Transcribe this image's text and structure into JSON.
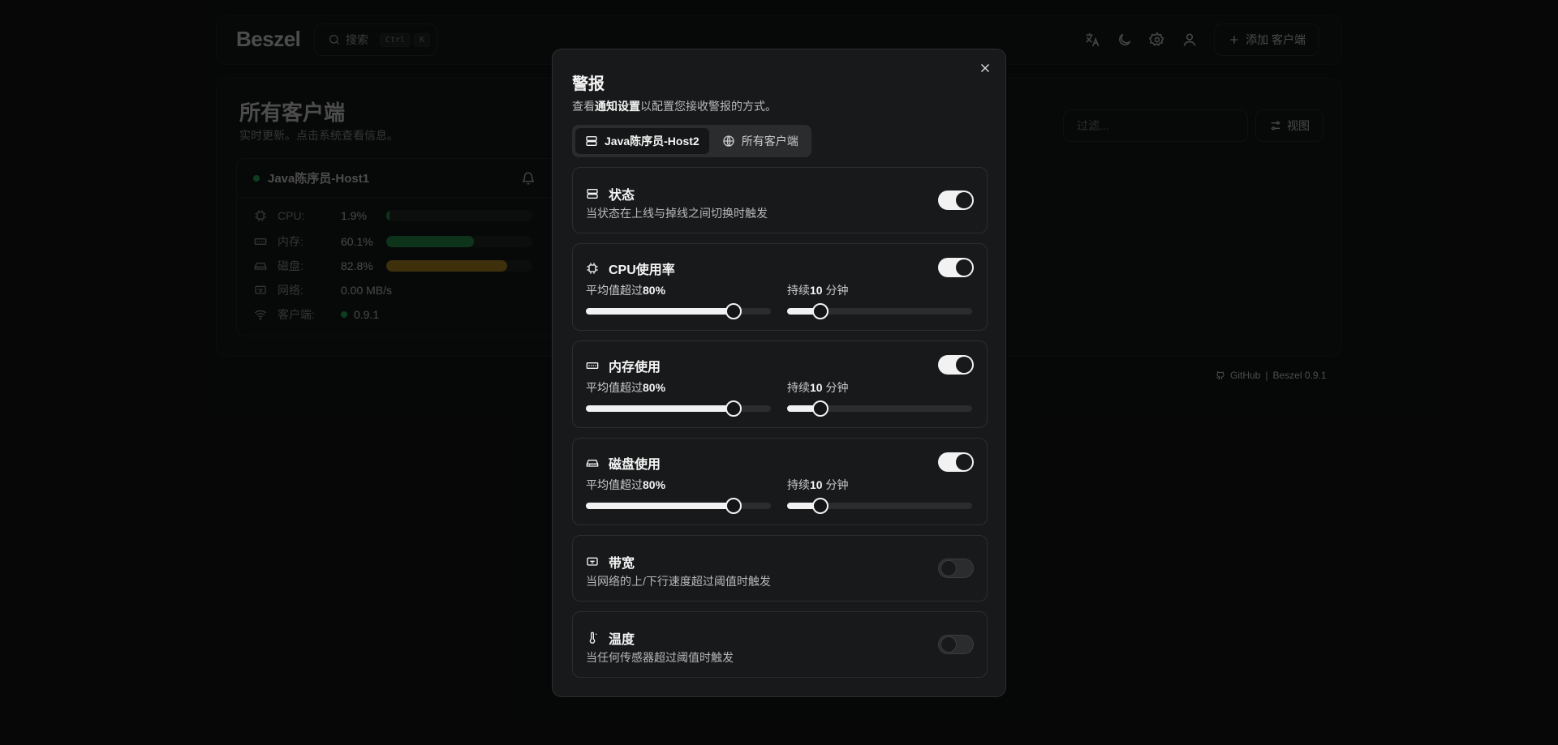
{
  "header": {
    "logo": "Beszel",
    "search_label": "搜索",
    "search_kbd1": "Ctrl",
    "search_kbd2": "K",
    "add_client_label": "添加 客户端"
  },
  "main": {
    "title": "所有客户端",
    "subtitle": "实时更新。点击系统查看信息。",
    "filter_placeholder": "过滤...",
    "view_label": "视图",
    "system": {
      "name": "Java陈序员-Host1",
      "metrics": [
        {
          "label": "CPU:",
          "value": "1.9%",
          "percent": 1.9,
          "color": "#22a34f"
        },
        {
          "label": "内存:",
          "value": "60.1%",
          "percent": 60.1,
          "color": "#22a34f"
        },
        {
          "label": "磁盘:",
          "value": "82.8%",
          "percent": 82.8,
          "color": "#c7961a"
        },
        {
          "label": "网络:",
          "value": "0.00 MB/s"
        },
        {
          "label": "客户端:",
          "value": "0.9.1"
        }
      ]
    }
  },
  "footer": {
    "github": "GitHub",
    "separator": "|",
    "version": "Beszel 0.9.1"
  },
  "dialog": {
    "title": "警报",
    "desc_prefix": "查看",
    "desc_link": "通知设置",
    "desc_suffix": "以配置您接收警报的方式。",
    "tabs": [
      {
        "label": "Java陈序员-Host2",
        "active": true
      },
      {
        "label": "所有客户端",
        "active": false
      }
    ],
    "alerts": [
      {
        "title": "状态",
        "desc": "当状态在上线与掉线之间切换时触发",
        "enabled": true
      },
      {
        "title": "CPU使用率",
        "enabled": true,
        "avg_prefix": "平均值超过",
        "avg_value": "80%",
        "avg_percent": 80,
        "dur_prefix": "持续",
        "dur_value": "10",
        "dur_unit": "分钟",
        "dur_percent": 18
      },
      {
        "title": "内存使用",
        "enabled": true,
        "avg_prefix": "平均值超过",
        "avg_value": "80%",
        "avg_percent": 80,
        "dur_prefix": "持续",
        "dur_value": "10",
        "dur_unit": "分钟",
        "dur_percent": 18
      },
      {
        "title": "磁盘使用",
        "enabled": true,
        "avg_prefix": "平均值超过",
        "avg_value": "80%",
        "avg_percent": 80,
        "dur_prefix": "持续",
        "dur_value": "10",
        "dur_unit": "分钟",
        "dur_percent": 18
      },
      {
        "title": "带宽",
        "desc": "当网络的上/下行速度超过阈值时触发",
        "enabled": false
      },
      {
        "title": "温度",
        "desc": "当任何传感器超过阈值时触发",
        "enabled": false
      }
    ]
  }
}
